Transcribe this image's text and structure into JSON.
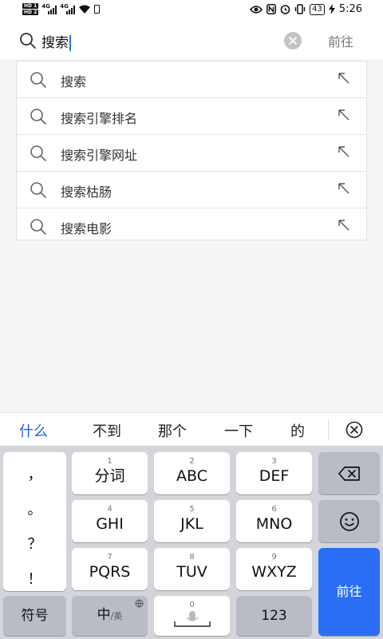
{
  "status_bar": {
    "hd1": "HD 1",
    "hd2": "HD 2",
    "network1": "4G",
    "network2": "4G",
    "battery_level": "43",
    "time": "5:26"
  },
  "search": {
    "query": "搜索",
    "go_label": "前往"
  },
  "suggestions": [
    {
      "text": "搜索"
    },
    {
      "text": "搜索引擎排名"
    },
    {
      "text": "搜索引擎网址"
    },
    {
      "text": "搜索枯肠"
    },
    {
      "text": "搜索电影"
    }
  ],
  "candidates": [
    "什么",
    "不到",
    "那个",
    "一下",
    "的"
  ],
  "keyboard": {
    "punctuation": [
      "，",
      "。",
      "？",
      "！"
    ],
    "keys": [
      {
        "num": "1",
        "label": "分词"
      },
      {
        "num": "2",
        "label": "ABC"
      },
      {
        "num": "3",
        "label": "DEF"
      },
      {
        "num": "4",
        "label": "GHI"
      },
      {
        "num": "5",
        "label": "JKL"
      },
      {
        "num": "6",
        "label": "MNO"
      },
      {
        "num": "7",
        "label": "PQRS"
      },
      {
        "num": "8",
        "label": "TUV"
      },
      {
        "num": "9",
        "label": "WXYZ"
      }
    ],
    "symbols_label": "符号",
    "lang_main": "中",
    "lang_alt": "/英",
    "space_num": "0",
    "numbers_label": "123",
    "enter_label": "前往"
  },
  "colors": {
    "accent": "#2a6ef5",
    "candidate_active": "#1f64e8"
  }
}
